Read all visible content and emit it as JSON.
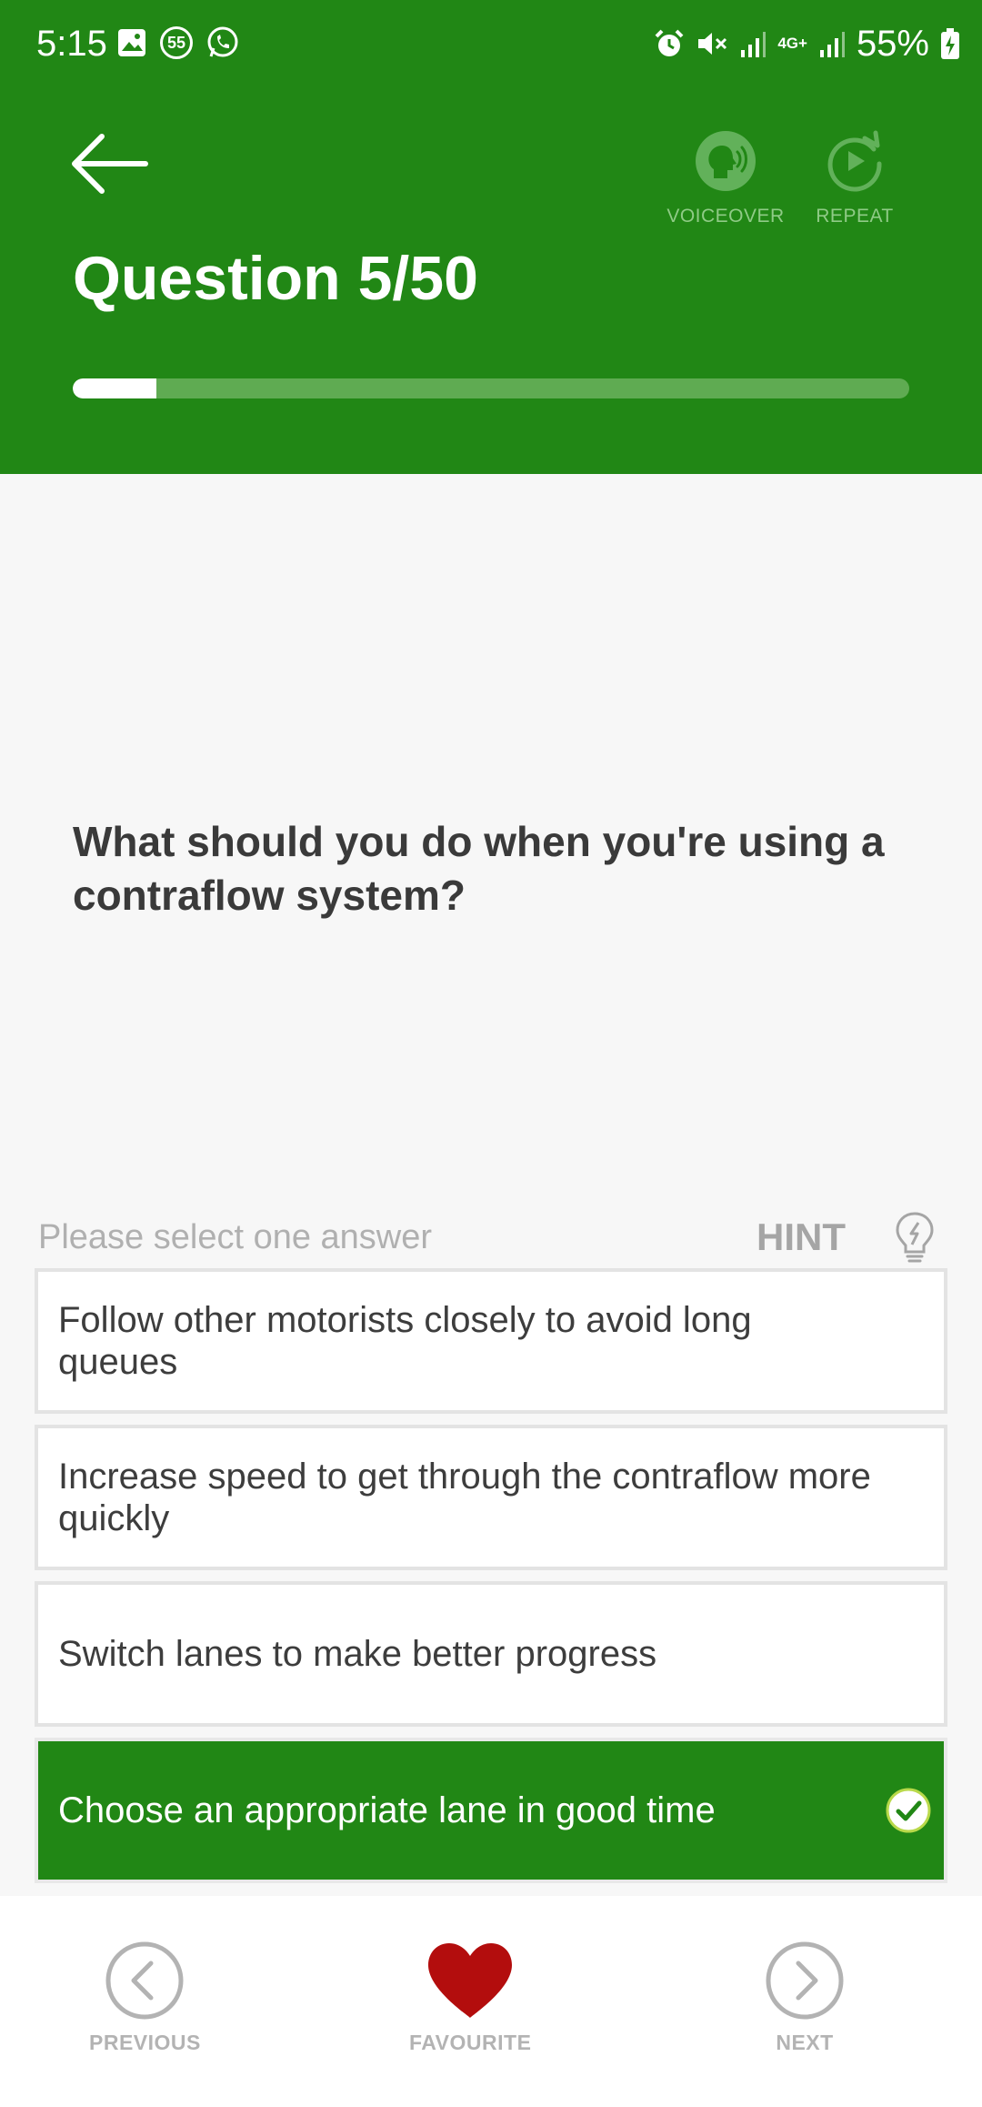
{
  "status": {
    "time": "5:15",
    "notif_badge": "55",
    "network": "4G+",
    "battery": "55%"
  },
  "header": {
    "title": "Question 5/50",
    "voiceover_label": "VOICEOVER",
    "repeat_label": "REPEAT",
    "progress_fraction": 0.1,
    "accent_color": "#218715"
  },
  "question": {
    "text": "What should you do when you're using a contraflow system?",
    "instruction": "Please select one answer",
    "hint_label": "HINT"
  },
  "answers": [
    {
      "text": "Follow other motorists closely to avoid long queues",
      "selected": false
    },
    {
      "text": "Increase speed to get through the contraflow more quickly",
      "selected": false
    },
    {
      "text": "Switch lanes to make better progress",
      "selected": false
    },
    {
      "text": "Choose an appropriate lane in good time",
      "selected": true
    }
  ],
  "bottom_nav": {
    "previous_label": "PREVIOUS",
    "favourite_label": "FAVOURITE",
    "next_label": "NEXT",
    "favourite_color": "#b30d0d"
  }
}
